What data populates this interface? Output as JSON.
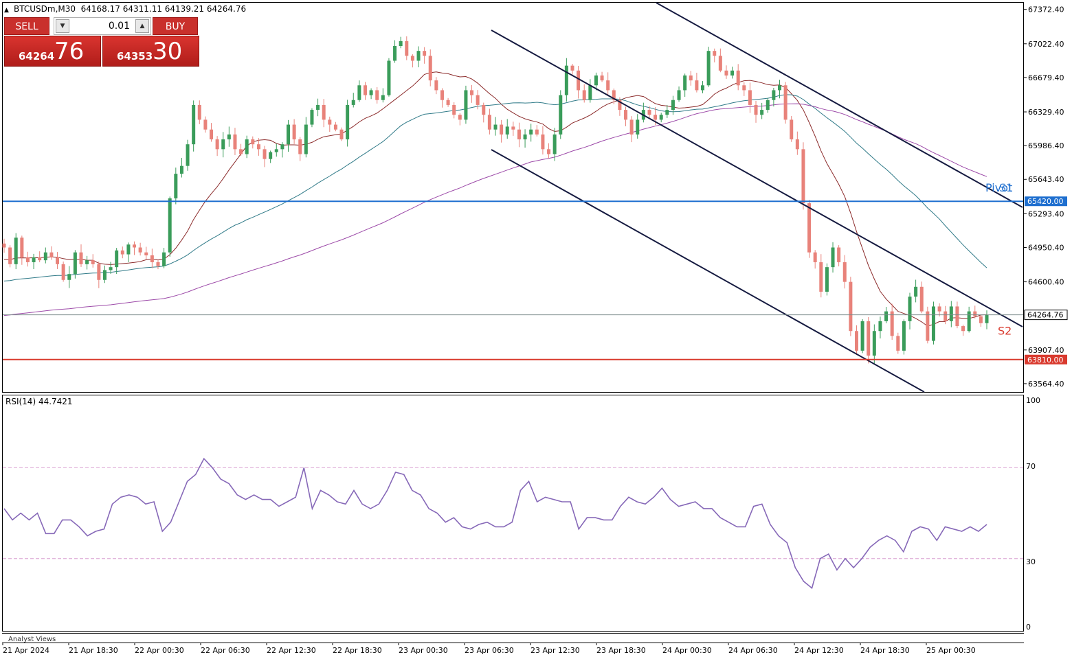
{
  "header": {
    "arrow": "▲",
    "text": "BTCUSDm,M30  64168.17 64311.11 64139.21 64264.76"
  },
  "trade_panel": {
    "sell_label": "SELL",
    "buy_label": "BUY",
    "volume": "0.01",
    "sell_price_small": "64264",
    "sell_price_big": "76",
    "buy_price_small": "64353",
    "buy_price_big": "30"
  },
  "rsi_panel": {
    "title": "RSI(14) 44.7421",
    "levels": [
      "100",
      "70",
      "30",
      "0"
    ]
  },
  "indicator_label": "Analyst Views",
  "colors": {
    "bull": "#3a9c5a",
    "bear": "#e8827a",
    "pivot": "#1f6fcf",
    "support": "#d93a2e",
    "channel": "#151a40",
    "rsi": "#8668b8",
    "ma_fast": "#8b2a2a",
    "ma_mid": "#2f7a88",
    "ma_slow": "#9c49a8"
  },
  "chart_data": [
    {
      "type": "candlestick",
      "symbol": "BTCUSDm",
      "timeframe": "M30",
      "ohlc_current": {
        "open": 64168.17,
        "high": 64311.11,
        "low": 64139.21,
        "close": 64264.76
      },
      "y_ticks": [
        "67372.40",
        "67022.40",
        "66679.40",
        "66329.40",
        "65986.40",
        "65643.40",
        "65293.40",
        "64950.40",
        "64600.40",
        "63907.40",
        "63564.40"
      ],
      "ylim": [
        63480,
        67440
      ],
      "x_ticks": [
        "21 Apr 2024",
        "21 Apr 18:30",
        "22 Apr 00:30",
        "22 Apr 06:30",
        "22 Apr 12:30",
        "22 Apr 18:30",
        "23 Apr 00:30",
        "23 Apr 06:30",
        "23 Apr 12:30",
        "23 Apr 18:30",
        "24 Apr 00:30",
        "24 Apr 06:30",
        "24 Apr 12:30",
        "24 Apr 18:30",
        "25 Apr 00:30"
      ],
      "current_price": {
        "value": 64264.76,
        "label": "64264.76"
      },
      "levels": [
        {
          "name": "Pivot",
          "value": 65420.0,
          "label": "65420.00"
        },
        {
          "name": "S2",
          "value": 63810.0,
          "label": "63810.00"
        }
      ],
      "level_tags": [
        "Pivot",
        "S1",
        "S2"
      ],
      "closes": [
        64950,
        64780,
        65050,
        64850,
        64800,
        64850,
        64820,
        64900,
        64850,
        64780,
        64620,
        64680,
        64900,
        64780,
        64820,
        64780,
        64620,
        64720,
        64750,
        64920,
        64880,
        64980,
        64950,
        64900,
        64870,
        64800,
        64760,
        64900,
        65450,
        65700,
        65780,
        66000,
        66400,
        66250,
        66150,
        66050,
        65950,
        66050,
        66100,
        65950,
        65900,
        66050,
        66000,
        65950,
        65850,
        65920,
        65950,
        66000,
        66200,
        66050,
        65900,
        66200,
        66350,
        66400,
        66250,
        66200,
        66150,
        66050,
        66400,
        66450,
        66600,
        66500,
        66550,
        66450,
        66500,
        66850,
        67000,
        67050,
        66900,
        66850,
        66950,
        66900,
        66650,
        66550,
        66450,
        66400,
        66300,
        66250,
        66550,
        66500,
        66400,
        66300,
        66150,
        66200,
        66100,
        66180,
        66150,
        66050,
        66100,
        66150,
        66100,
        65950,
        65900,
        66100,
        66500,
        66800,
        66750,
        66550,
        66450,
        66600,
        66700,
        66650,
        66550,
        66450,
        66350,
        66250,
        66100,
        66250,
        66350,
        66300,
        66250,
        66300,
        66350,
        66450,
        66550,
        66700,
        66650,
        66550,
        66600,
        66950,
        66900,
        66750,
        66700,
        66750,
        66600,
        66550,
        66400,
        66300,
        66350,
        66450,
        66550,
        66600,
        66250,
        66050,
        65950,
        65400,
        64900,
        64800,
        64500,
        64750,
        64950,
        64800,
        64600,
        64100,
        63900,
        64200,
        63850,
        64100,
        64200,
        64300,
        64050,
        63900,
        64200,
        64450,
        64550,
        64300,
        64000,
        64350,
        64300,
        64200,
        64350,
        64150,
        64100,
        64300,
        64250,
        64180,
        64265
      ]
    },
    {
      "type": "line",
      "name": "RSI(14)",
      "value": 44.7421,
      "ylim": [
        0,
        100
      ],
      "levels": [
        70,
        30
      ],
      "values": [
        52,
        47,
        50,
        47,
        50,
        41,
        41,
        47,
        47,
        44,
        40,
        42,
        43,
        54,
        57,
        58,
        57,
        54,
        55,
        42,
        46,
        55,
        64,
        67,
        74,
        70,
        65,
        63,
        58,
        56,
        58,
        56,
        56,
        53,
        55,
        57,
        70,
        52,
        60,
        58,
        55,
        54,
        60,
        54,
        52,
        54,
        60,
        68,
        67,
        60,
        58,
        52,
        50,
        46,
        48,
        44,
        43,
        45,
        46,
        44,
        44,
        46,
        60,
        64,
        55,
        57,
        56,
        55,
        55,
        43,
        48,
        48,
        47,
        47,
        53,
        57,
        55,
        54,
        57,
        61,
        56,
        53,
        54,
        55,
        52,
        52,
        48,
        46,
        44,
        44,
        53,
        54,
        45,
        40,
        37,
        26,
        20,
        17,
        30,
        32,
        25,
        30,
        26,
        30,
        35,
        38,
        40,
        38,
        33,
        42,
        44,
        43,
        38,
        44,
        43,
        42,
        44,
        42,
        45
      ]
    }
  ]
}
